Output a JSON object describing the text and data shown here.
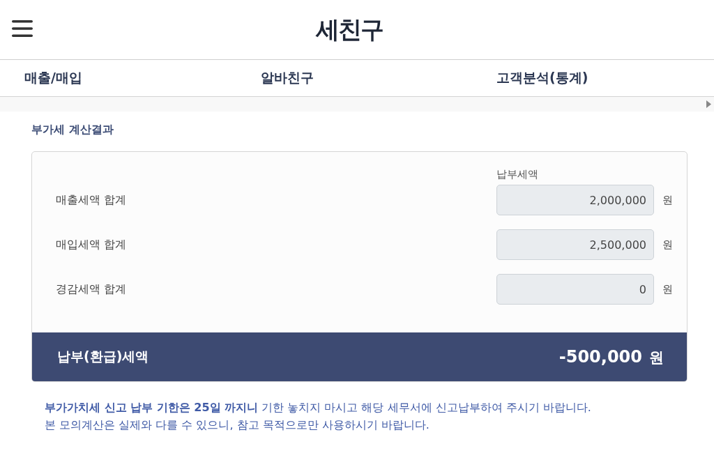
{
  "header": {
    "logo": "세친구"
  },
  "nav": {
    "tabs": [
      {
        "label": "매출/매입",
        "selected": false
      },
      {
        "label": "알바친구",
        "selected": false
      },
      {
        "label": "고객분석(통계)",
        "selected": false
      }
    ]
  },
  "section_title": "부가세 계산결과",
  "result_card": {
    "column_header": "납부세액",
    "rows": [
      {
        "label": "매출세액 합계",
        "value": "2,000,000",
        "unit": "원"
      },
      {
        "label": "매입세액 합계",
        "value": "2,500,000",
        "unit": "원"
      },
      {
        "label": "경감세액 합계",
        "value": "0",
        "unit": "원"
      }
    ],
    "total": {
      "label": "납부(환급)세액",
      "value": "-500,000",
      "unit": "원"
    }
  },
  "notes": [
    "**부가가치세 신고 납부 기한은 25일 까지니** 기한 놓치지 마시고 해당 세무서에 신고납부하여 주시기 바랍니다.",
    "본 모의계산은 실제와 다를 수 있으니, 참고 목적으로만 사용하시기 바랍니다."
  ]
}
